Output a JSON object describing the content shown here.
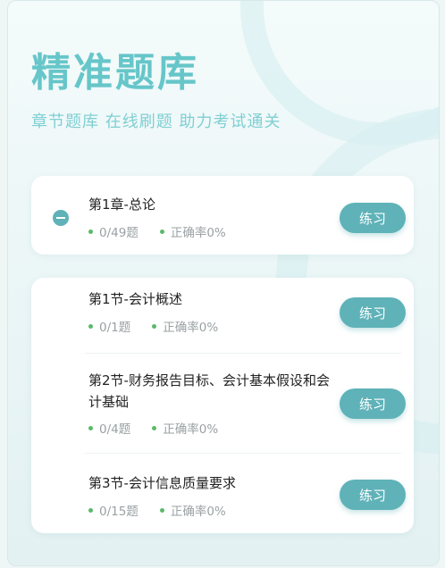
{
  "header": {
    "title": "精准题库",
    "subtitle": "章节题库 在线刷题 助力考试通关"
  },
  "chapter": {
    "title": "第1章-总论",
    "progress": "0/49题",
    "accuracy": "正确率0%",
    "button": "练习"
  },
  "sections": [
    {
      "title": "第1节-会计概述",
      "progress": "0/1题",
      "accuracy": "正确率0%",
      "button": "练习"
    },
    {
      "title": "第2节-财务报告目标、会计基本假设和会计基础",
      "progress": "0/4题",
      "accuracy": "正确率0%",
      "button": "练习"
    },
    {
      "title": "第3节-会计信息质量要求",
      "progress": "0/15题",
      "accuracy": "正确率0%",
      "button": "练习"
    }
  ],
  "colors": {
    "accent": "#5fb2b8",
    "title": "#66c6c9",
    "dot": "#5ab96a"
  }
}
